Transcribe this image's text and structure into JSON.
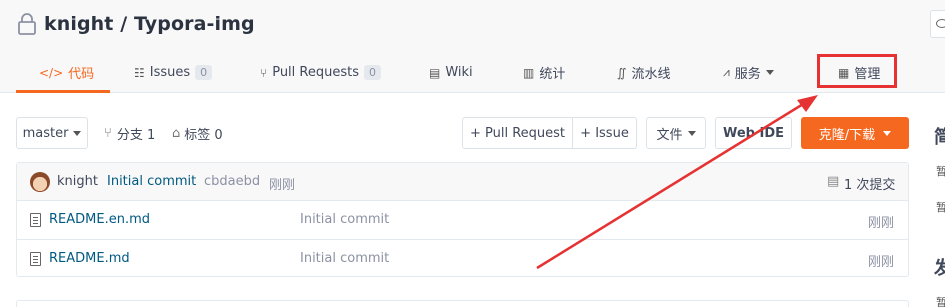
{
  "repo": {
    "title": "knight / Typora-img"
  },
  "tabs": [
    {
      "label": "代码",
      "icon": "code-icon"
    },
    {
      "label": "Issues",
      "count": "0",
      "icon": "issues-icon"
    },
    {
      "label": "Pull Requests",
      "count": "0",
      "icon": "pull-request-icon"
    },
    {
      "label": "Wiki",
      "icon": "wiki-icon"
    },
    {
      "label": "统计",
      "icon": "stats-icon"
    },
    {
      "label": "流水线",
      "icon": "pipeline-icon"
    },
    {
      "label": "服务",
      "icon": "service-icon"
    },
    {
      "label": "管理",
      "icon": "manage-icon"
    }
  ],
  "toolbar": {
    "branch": "master",
    "branches": "分支 1",
    "tags": "标签 0",
    "pull_request": "+ Pull Request",
    "issue": "+ Issue",
    "file": "文件",
    "web_ide": "Web IDE",
    "clone": "克隆/下载"
  },
  "commit": {
    "author": "knight",
    "message": "Initial commit",
    "hash": "cbdaebd",
    "time": "刚刚",
    "count": "1 次提交"
  },
  "files": [
    {
      "name": "README.en.md",
      "message": "Initial commit",
      "time": "刚刚"
    },
    {
      "name": "README.md",
      "message": "Initial commit",
      "time": "刚刚"
    }
  ],
  "sidebar": {
    "head1": "简",
    "line1": "暂",
    "line2": "暂",
    "head2": "发",
    "line3": "暂"
  },
  "colors": {
    "accent": "#f5681f",
    "annotation": "#e63232",
    "link": "#005980"
  }
}
